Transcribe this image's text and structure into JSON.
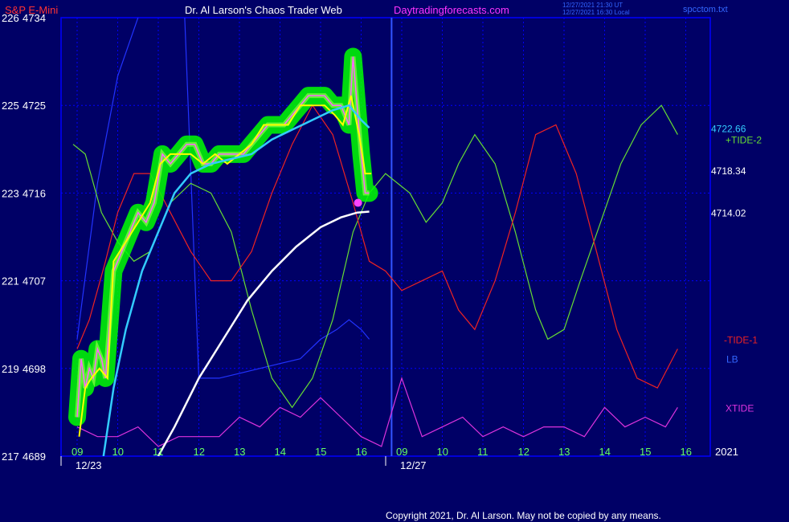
{
  "header": {
    "symbol": "S&P E-Mini",
    "title": "Dr. Al Larson's Chaos Trader Web",
    "site": "Daytradingforecasts.com",
    "stamp_line1": "12/27/2021 21:30 UT",
    "stamp_line2": "12/27/2021 16:30 Local",
    "file": "spcctom.txt"
  },
  "footer": {
    "copyright": "Copyright 2021, Dr. Al Larson. May not be copied by any means."
  },
  "colors": {
    "background": "#000066",
    "grid": "#0000ff",
    "axis_label": "#ffffff",
    "symbol": "#ff3333",
    "title": "#ffffff",
    "site": "#ff33ff",
    "price": "#ff66ff",
    "mean": "#ffff00",
    "glow": "#00ff00",
    "avg_fast": "#33ccff",
    "avg_slow": "#ffffff",
    "tide_plus": "#66dd33",
    "tide_minus": "#ee2222",
    "lb": "#2233ff",
    "xtide": "#dd33dd",
    "hour_label": "#66ff66"
  },
  "chart_data": {
    "type": "line",
    "y_left_labels": [
      {
        "small": "226",
        "price": "4734"
      },
      {
        "small": "225",
        "price": "4725"
      },
      {
        "small": "223",
        "price": "4716"
      },
      {
        "small": "221",
        "price": "4707"
      },
      {
        "small": "219",
        "price": "4698"
      },
      {
        "small": "217",
        "price": "4689"
      }
    ],
    "ylim": [
      4689,
      4734
    ],
    "x_hour_labels": [
      "09",
      "10",
      "11",
      "12",
      "13",
      "14",
      "15",
      "16",
      "09",
      "10",
      "11",
      "12",
      "13",
      "14",
      "15",
      "16"
    ],
    "date_labels": [
      "12/23",
      "12/27"
    ],
    "year_label": "2021",
    "price_tags": [
      "4722.66",
      "4718.34",
      "4714.02"
    ],
    "series_labels": {
      "tide_plus": "+TIDE-2",
      "tide_minus": "-TIDE-1",
      "lb": "LB",
      "xtide": "XTIDE"
    },
    "series": {
      "price_path": [
        [
          0.0,
          4693
        ],
        [
          0.1,
          4699
        ],
        [
          0.2,
          4696
        ],
        [
          0.3,
          4698
        ],
        [
          0.4,
          4697
        ],
        [
          0.5,
          4700
        ],
        [
          0.6,
          4699
        ],
        [
          0.7,
          4697
        ],
        [
          0.9,
          4708
        ],
        [
          1.1,
          4710
        ],
        [
          1.3,
          4712
        ],
        [
          1.5,
          4714
        ],
        [
          1.7,
          4713
        ],
        [
          1.9,
          4715
        ],
        [
          2.1,
          4720
        ],
        [
          2.3,
          4719
        ],
        [
          2.5,
          4720
        ],
        [
          2.7,
          4721
        ],
        [
          2.9,
          4721
        ],
        [
          3.1,
          4719
        ],
        [
          3.3,
          4719
        ],
        [
          3.5,
          4720
        ],
        [
          3.7,
          4720
        ],
        [
          3.9,
          4720
        ],
        [
          4.1,
          4720
        ],
        [
          4.3,
          4721
        ],
        [
          4.5,
          4722
        ],
        [
          4.7,
          4723
        ],
        [
          4.9,
          4723
        ],
        [
          5.1,
          4723
        ],
        [
          5.3,
          4724
        ],
        [
          5.5,
          4725
        ],
        [
          5.7,
          4726
        ],
        [
          5.9,
          4726
        ],
        [
          6.1,
          4726
        ],
        [
          6.3,
          4725
        ],
        [
          6.5,
          4725
        ],
        [
          6.7,
          4723
        ],
        [
          6.8,
          4730
        ],
        [
          6.9,
          4725
        ],
        [
          7.0,
          4720
        ],
        [
          7.1,
          4716
        ],
        [
          7.2,
          4716
        ]
      ],
      "mean_path": [
        [
          0.05,
          4691
        ],
        [
          0.2,
          4696
        ],
        [
          0.35,
          4697
        ],
        [
          0.55,
          4698
        ],
        [
          0.75,
          4697
        ],
        [
          0.9,
          4709
        ],
        [
          1.2,
          4711
        ],
        [
          1.5,
          4713
        ],
        [
          1.8,
          4715
        ],
        [
          2.05,
          4719
        ],
        [
          2.3,
          4720
        ],
        [
          2.55,
          4720
        ],
        [
          2.8,
          4720
        ],
        [
          3.1,
          4719
        ],
        [
          3.4,
          4720
        ],
        [
          3.7,
          4719
        ],
        [
          4.0,
          4720
        ],
        [
          4.3,
          4721
        ],
        [
          4.6,
          4723
        ],
        [
          4.9,
          4723
        ],
        [
          5.2,
          4723
        ],
        [
          5.5,
          4725
        ],
        [
          5.8,
          4725
        ],
        [
          6.1,
          4725
        ],
        [
          6.35,
          4724
        ],
        [
          6.55,
          4723
        ],
        [
          6.75,
          4726
        ],
        [
          6.95,
          4722
        ],
        [
          7.1,
          4718
        ],
        [
          7.25,
          4718
        ]
      ],
      "avg_fast": [
        [
          0.65,
          4689
        ],
        [
          0.9,
          4696
        ],
        [
          1.2,
          4702
        ],
        [
          1.6,
          4708
        ],
        [
          2.0,
          4712
        ],
        [
          2.4,
          4716
        ],
        [
          2.8,
          4718
        ],
        [
          3.3,
          4719
        ],
        [
          3.8,
          4719.5
        ],
        [
          4.3,
          4720
        ],
        [
          4.8,
          4721.5
        ],
        [
          5.3,
          4722.5
        ],
        [
          5.8,
          4723.5
        ],
        [
          6.3,
          4724.5
        ],
        [
          6.7,
          4725
        ],
        [
          7.0,
          4723.5
        ],
        [
          7.2,
          4722.7
        ]
      ],
      "avg_slow": [
        [
          2.0,
          4689
        ],
        [
          2.4,
          4692
        ],
        [
          3.0,
          4697
        ],
        [
          3.6,
          4701
        ],
        [
          4.2,
          4705
        ],
        [
          4.8,
          4708
        ],
        [
          5.4,
          4710.5
        ],
        [
          6.0,
          4712.5
        ],
        [
          6.5,
          4713.5
        ],
        [
          6.9,
          4714
        ],
        [
          7.2,
          4714.1
        ]
      ],
      "tide_plus": [
        [
          -0.1,
          4721
        ],
        [
          0.2,
          4720
        ],
        [
          0.6,
          4714
        ],
        [
          1.0,
          4711
        ],
        [
          1.4,
          4709
        ],
        [
          1.8,
          4710
        ],
        [
          2.3,
          4715
        ],
        [
          2.8,
          4717
        ],
        [
          3.3,
          4716
        ],
        [
          3.8,
          4712
        ],
        [
          4.3,
          4704
        ],
        [
          4.8,
          4697
        ],
        [
          5.3,
          4694
        ],
        [
          5.8,
          4697
        ],
        [
          6.3,
          4703
        ],
        [
          6.8,
          4712
        ],
        [
          7.2,
          4716
        ],
        [
          7.6,
          4718
        ],
        [
          8.2,
          4716
        ],
        [
          8.6,
          4713
        ],
        [
          9.0,
          4715
        ],
        [
          9.4,
          4719
        ],
        [
          9.8,
          4722
        ],
        [
          10.3,
          4719
        ],
        [
          10.8,
          4712
        ],
        [
          11.3,
          4704
        ],
        [
          11.6,
          4701
        ],
        [
          12.0,
          4702
        ],
        [
          12.4,
          4707
        ],
        [
          12.9,
          4713
        ],
        [
          13.4,
          4719
        ],
        [
          13.9,
          4723
        ],
        [
          14.4,
          4725
        ],
        [
          14.8,
          4722
        ]
      ],
      "tide_minus": [
        [
          0.0,
          4700
        ],
        [
          0.3,
          4703
        ],
        [
          0.7,
          4709
        ],
        [
          1.0,
          4714
        ],
        [
          1.4,
          4718
        ],
        [
          1.8,
          4718
        ],
        [
          2.3,
          4714
        ],
        [
          2.8,
          4710
        ],
        [
          3.3,
          4707
        ],
        [
          3.8,
          4707
        ],
        [
          4.3,
          4710
        ],
        [
          4.8,
          4716
        ],
        [
          5.3,
          4721
        ],
        [
          5.8,
          4725
        ],
        [
          6.3,
          4722
        ],
        [
          6.8,
          4715
        ],
        [
          7.2,
          4709
        ],
        [
          7.6,
          4708
        ],
        [
          8.0,
          4706
        ],
        [
          8.5,
          4707
        ],
        [
          9.0,
          4708
        ],
        [
          9.4,
          4704
        ],
        [
          9.8,
          4702
        ],
        [
          10.3,
          4707
        ],
        [
          10.8,
          4714
        ],
        [
          11.3,
          4722
        ],
        [
          11.8,
          4723
        ],
        [
          12.3,
          4718
        ],
        [
          12.8,
          4710
        ],
        [
          13.3,
          4702
        ],
        [
          13.8,
          4697
        ],
        [
          14.3,
          4696
        ],
        [
          14.8,
          4700
        ]
      ],
      "lb": [
        [
          0.0,
          4701
        ],
        [
          0.5,
          4717
        ],
        [
          1.0,
          4728
        ],
        [
          1.5,
          4734
        ],
        [
          2.0,
          4742
        ],
        [
          2.5,
          4750
        ],
        [
          3.0,
          4697
        ],
        [
          3.5,
          4697
        ],
        [
          4.0,
          4697.5
        ],
        [
          4.5,
          4698
        ],
        [
          5.0,
          4698.5
        ],
        [
          5.5,
          4699
        ],
        [
          6.0,
          4701
        ],
        [
          6.4,
          4702
        ],
        [
          6.7,
          4703
        ],
        [
          7.0,
          4702
        ],
        [
          7.2,
          4701
        ]
      ],
      "xtide": [
        [
          0.0,
          4692
        ],
        [
          0.5,
          4691
        ],
        [
          1.0,
          4691
        ],
        [
          1.5,
          4692
        ],
        [
          2.0,
          4690
        ],
        [
          2.5,
          4691
        ],
        [
          3.0,
          4691
        ],
        [
          3.5,
          4691
        ],
        [
          4.0,
          4693
        ],
        [
          4.5,
          4692
        ],
        [
          5.0,
          4694
        ],
        [
          5.5,
          4693
        ],
        [
          6.0,
          4695
        ],
        [
          6.5,
          4693
        ],
        [
          7.0,
          4691
        ],
        [
          7.5,
          4690
        ],
        [
          8.0,
          4697
        ],
        [
          8.5,
          4691
        ],
        [
          9.0,
          4692
        ],
        [
          9.5,
          4693
        ],
        [
          10.0,
          4691
        ],
        [
          10.5,
          4692
        ],
        [
          11.0,
          4691
        ],
        [
          11.5,
          4692
        ],
        [
          12.0,
          4692
        ],
        [
          12.5,
          4691
        ],
        [
          13.0,
          4694
        ],
        [
          13.5,
          4692
        ],
        [
          14.0,
          4693
        ],
        [
          14.5,
          4692
        ],
        [
          14.8,
          4694
        ]
      ]
    }
  }
}
